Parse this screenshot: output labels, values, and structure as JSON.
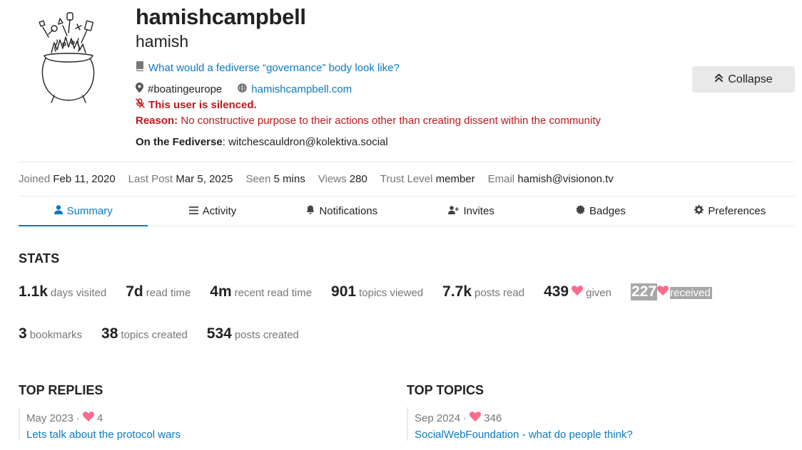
{
  "profile": {
    "username": "hamishcampbell",
    "name": "hamish",
    "featured_topic": "What would a fediverse “governance” body look like?",
    "location": "#boatingeurope",
    "website": "hamishcampbell.com",
    "silenced_label": "This user is silenced.",
    "reason_label": "Reason:",
    "reason_text": "No constructive purpose to their actions other than creating dissent within the community",
    "fediverse_label": "On the Fediverse",
    "fediverse_handle": "witchescauldron@kolektiva.social"
  },
  "collapse_button": {
    "label": "Collapse",
    "icon": "double-chevron-up-icon"
  },
  "info_bar": [
    {
      "label": "Joined",
      "value": "Feb 11, 2020"
    },
    {
      "label": "Last Post",
      "value": "Mar 5, 2025"
    },
    {
      "label": "Seen",
      "value": "5 mins"
    },
    {
      "label": "Views",
      "value": "280"
    },
    {
      "label": "Trust Level",
      "value": "member"
    },
    {
      "label": "Email",
      "value": "hamish@visionon.tv"
    }
  ],
  "nav": {
    "tabs": [
      {
        "label": "Summary",
        "icon": "user-icon",
        "active": true
      },
      {
        "label": "Activity",
        "icon": "list-icon"
      },
      {
        "label": "Notifications",
        "icon": "bell-icon"
      },
      {
        "label": "Invites",
        "icon": "user-plus-icon"
      },
      {
        "label": "Badges",
        "icon": "certificate-icon"
      },
      {
        "label": "Preferences",
        "icon": "gear-icon"
      }
    ]
  },
  "stats": {
    "title": "STATS",
    "row1": [
      {
        "value": "1.1k",
        "label": "days visited"
      },
      {
        "value": "7d",
        "label": "read time"
      },
      {
        "value": "4m",
        "label": "recent read time"
      },
      {
        "value": "901",
        "label": "topics viewed"
      },
      {
        "value": "7.7k",
        "label": "posts read"
      },
      {
        "value": "439",
        "label": "given"
      },
      {
        "value": "227",
        "label": "received"
      }
    ],
    "row2": [
      {
        "value": "3",
        "label": "bookmarks"
      },
      {
        "value": "38",
        "label": "topics created"
      },
      {
        "value": "534",
        "label": "posts created"
      }
    ]
  },
  "top_replies": {
    "title": "TOP REPLIES",
    "items": [
      {
        "date": "May 2023",
        "likes": "4",
        "title": "Lets talk about the protocol wars"
      }
    ]
  },
  "top_topics": {
    "title": "TOP TOPICS",
    "items": [
      {
        "date": "Sep 2024",
        "likes": "346",
        "title": "SocialWebFoundation - what do people think?"
      }
    ]
  },
  "colors": {
    "link": "#0a7ac4",
    "danger": "#c0161b",
    "heart": "#fa6c8d",
    "muted": "#777777",
    "highlight": "#a8a8a8"
  }
}
